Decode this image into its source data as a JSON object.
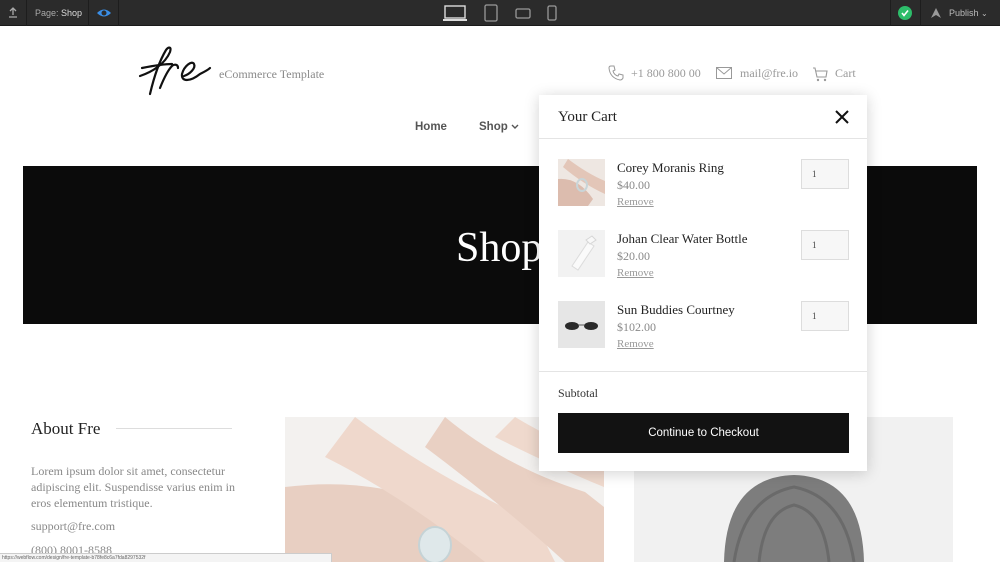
{
  "toolbar": {
    "page_label": "Page:",
    "page_name": "Shop",
    "publish_label": "Publish"
  },
  "header": {
    "logo_text": "fre",
    "tagline": "eCommerce Template",
    "phone": "+1 800 800 00",
    "email": "mail@fre.io",
    "cart_label": "Cart"
  },
  "nav": {
    "items": [
      {
        "label": "Home"
      },
      {
        "label": "Shop"
      }
    ]
  },
  "hero": {
    "title": "Shop"
  },
  "about": {
    "title": "About Fre",
    "text": "Lorem ipsum dolor sit amet, consectetur adipiscing elit. Suspendisse varius enim in eros elementum tristique.",
    "email": "support@fre.com",
    "phone": "(800) 8001-8588"
  },
  "status_url": "https://webflow.com/design/fre-template-b78fe8c6a7fda8297532f",
  "cart": {
    "title": "Your Cart",
    "items": [
      {
        "name": "Corey Moranis Ring",
        "price": "$40.00",
        "remove": "Remove",
        "qty": "1"
      },
      {
        "name": "Johan Clear Water Bottle",
        "price": "$20.00",
        "remove": "Remove",
        "qty": "1"
      },
      {
        "name": "Sun Buddies Courtney",
        "price": "$102.00",
        "remove": "Remove",
        "qty": "1"
      }
    ],
    "subtotal_label": "Subtotal",
    "checkout_label": "Continue to Checkout"
  },
  "colors": {
    "toolbar_bg": "#2b2b2b",
    "hero_bg": "#0b0b0b",
    "checkout_bg": "#121212",
    "status_ok": "#2dbd6a",
    "preview_eye": "#3a8ee6"
  }
}
